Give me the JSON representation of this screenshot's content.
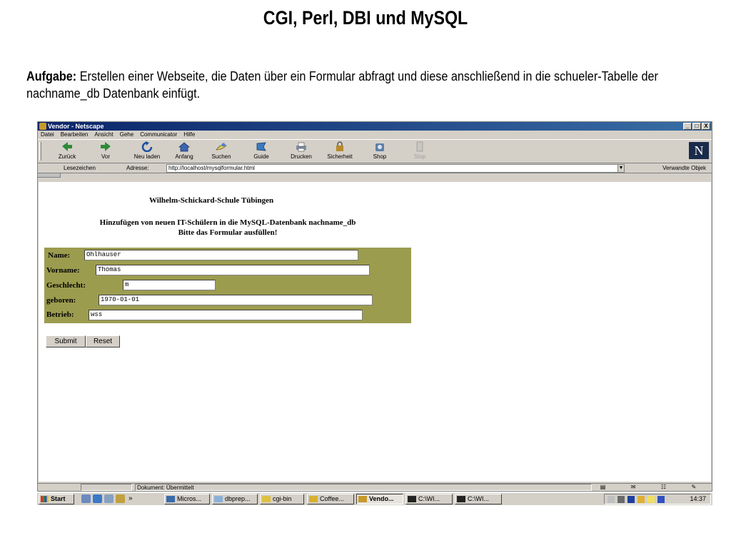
{
  "slide": {
    "title": "CGI, Perl, DBI und MySQL",
    "task_label": "Aufgabe:",
    "task_text": " Erstellen einer Webseite, die Daten über ein Formular abfragt und diese anschließend in die schueler-Tabelle der nachname_db Datenbank einfügt."
  },
  "window": {
    "title": "Vendor - Netscape",
    "controls": [
      "_",
      "□",
      "X"
    ]
  },
  "menu": [
    "Datei",
    "Bearbeiten",
    "Ansicht",
    "Gehe",
    "Communicator",
    "Hilfe"
  ],
  "toolbar": [
    {
      "label": "Zurück",
      "icon": "back-arrow-icon"
    },
    {
      "label": "Vor",
      "icon": "forward-arrow-icon"
    },
    {
      "label": "Neu laden",
      "icon": "reload-icon"
    },
    {
      "label": "Anfang",
      "icon": "home-icon"
    },
    {
      "label": "Suchen",
      "icon": "search-icon"
    },
    {
      "label": "Guide",
      "icon": "guide-icon"
    },
    {
      "label": "Drucken",
      "icon": "print-icon"
    },
    {
      "label": "Sicherheit",
      "icon": "lock-icon"
    },
    {
      "label": "Shop",
      "icon": "shop-icon"
    },
    {
      "label": "Stop",
      "icon": "stop-icon"
    }
  ],
  "location": {
    "bookmarks": "Lesezeichen",
    "address_label": "Adresse:",
    "url": "http://localhost/mysqlformular.html",
    "related": "Verwandte Objek"
  },
  "page": {
    "school": "Wilhelm-Schickard-Schule Tübingen",
    "subtitle_line1": "Hinzufügen von neuen IT-Schülern in die MySQL-Datenbank nachname_db",
    "subtitle_line2": "Bitte das Formular ausfüllen!",
    "fields": {
      "name_label": "Name:",
      "name_value": "Ohlhauser",
      "vorname_label": "Vorname:",
      "vorname_value": "Thomas",
      "geschlecht_label": "Geschlecht:",
      "geschlecht_value": "m",
      "geboren_label": "geboren:",
      "geboren_value": "1970-01-01",
      "betrieb_label": "Betrieb:",
      "betrieb_value": "wss"
    },
    "form_bg": "#9c9c4f",
    "submit": "Submit",
    "reset": "Reset"
  },
  "status": {
    "text": "Dokument: Übermittelt"
  },
  "taskbar": {
    "start": "Start",
    "more": "»",
    "tasks": [
      "Micros...",
      "dbprep...",
      "cgi-bin",
      "Coffee...",
      "Vendo...",
      "C:\\WI...",
      "C:\\WI..."
    ],
    "active_task": "Vendo...",
    "clock": "14:37"
  }
}
